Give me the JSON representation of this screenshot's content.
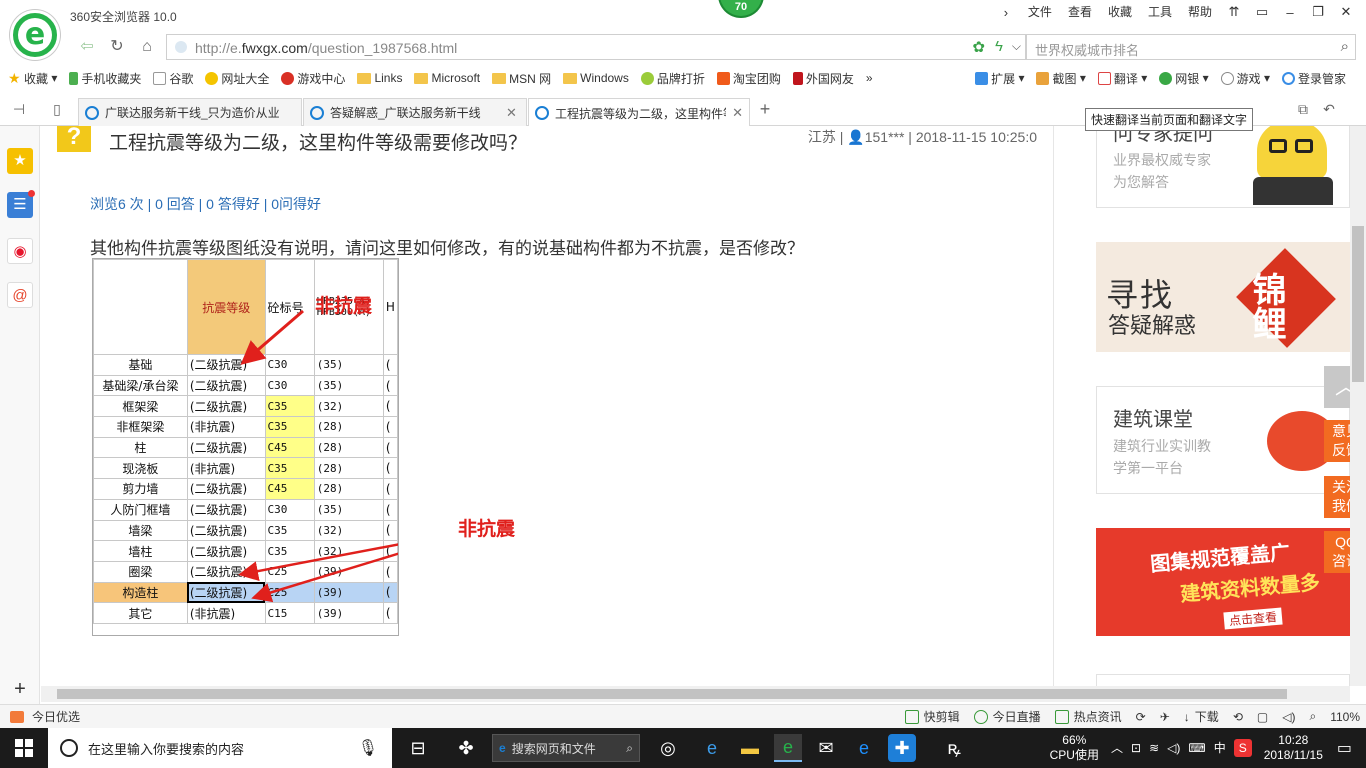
{
  "window": {
    "title": "360安全浏览器 10.0",
    "score": "70",
    "menu": [
      "文件",
      "查看",
      "收藏",
      "工具",
      "帮助"
    ]
  },
  "address": {
    "url_prefix": "http://e.",
    "url_domain": "fwxgx.com",
    "url_path": "/question_1987568.html",
    "search_placeholder": "世界权威城市排名"
  },
  "bookmarks": {
    "left": [
      "收藏",
      "手机收藏夹",
      "谷歌",
      "网址大全",
      "游戏中心",
      "Links",
      "Microsoft",
      "MSN 网",
      "Windows",
      "品牌打折",
      "淘宝团购",
      "外国网友"
    ],
    "more": "»",
    "right": [
      "扩展",
      "截图",
      "翻译",
      "网银",
      "游戏",
      "登录管家"
    ]
  },
  "tabs": [
    {
      "label": "广联达服务新干线_只为造价从业"
    },
    {
      "label": "答疑解惑_广联达服务新干线"
    },
    {
      "label": "工程抗震等级为二级，这里构件等"
    }
  ],
  "tooltip": "快速翻译当前页面和翻译文字",
  "question": {
    "icon": "?",
    "title": "工程抗震等级为二级，这里构件等级需要修改吗？",
    "meta": "江苏 | 👤151*** | 2018-11-15 10:25:0",
    "stats": "浏览6 次 | 0 回答 | 0 答得好 | 0问得好",
    "body": "其他构件抗震等级图纸没有说明，请问这里如何修改，有的说基础构件都为不抗震，是否修改？"
  },
  "figure": {
    "header_level": "抗震等级",
    "header_concrete": "砼标号",
    "header_steel": "HPB235(A)\nHPB300(A)",
    "header_h": "H",
    "rows": [
      {
        "name": "基础",
        "level": "(二级抗震)",
        "conc": "C30",
        "steel": "(35)",
        "yellow": false
      },
      {
        "name": "基础梁/承台梁",
        "level": "(二级抗震)",
        "conc": "C30",
        "steel": "(35)",
        "yellow": false
      },
      {
        "name": "框架梁",
        "level": "(二级抗震)",
        "conc": "C35",
        "steel": "(32)",
        "yellow": true
      },
      {
        "name": "非框架梁",
        "level": "(非抗震)",
        "conc": "C35",
        "steel": "(28)",
        "yellow": true
      },
      {
        "name": "柱",
        "level": "(二级抗震)",
        "conc": "C45",
        "steel": "(28)",
        "yellow": true
      },
      {
        "name": "现浇板",
        "level": "(非抗震)",
        "conc": "C35",
        "steel": "(28)",
        "yellow": true
      },
      {
        "name": "剪力墙",
        "level": "(二级抗震)",
        "conc": "C45",
        "steel": "(28)",
        "yellow": true
      },
      {
        "name": "人防门框墙",
        "level": "(二级抗震)",
        "conc": "C30",
        "steel": "(35)",
        "yellow": false
      },
      {
        "name": "墙梁",
        "level": "(二级抗震)",
        "conc": "C35",
        "steel": "(32)",
        "yellow": false
      },
      {
        "name": "墙柱",
        "level": "(二级抗震)",
        "conc": "C35",
        "steel": "(32)",
        "yellow": false
      },
      {
        "name": "圈梁",
        "level": "(二级抗震)",
        "conc": "C25",
        "steel": "(39)",
        "yellow": false
      },
      {
        "name": "构造柱",
        "level": "(二级抗震)",
        "conc": "C25",
        "steel": "(39)",
        "yellow": false,
        "selected": true
      },
      {
        "name": "其它",
        "level": "(非抗震)",
        "conc": "C15",
        "steel": "(39)",
        "yellow": false
      }
    ],
    "annotation_1": "非抗震",
    "annotation_2": "非抗震"
  },
  "sidebar_right": {
    "ad1_title": "问专家提问",
    "ad1_sub1": "业界最权威专家",
    "ad1_sub2": "为您解答",
    "ad2_text1": "寻找",
    "ad2_text2": "答疑解惑",
    "ad2_text3": "锦鲤",
    "ad3_title": "建筑课堂",
    "ad3_sub1": "建筑行业实训教",
    "ad3_sub2": "学第一平台",
    "ad4_text1": "图集规范覆盖广",
    "ad4_text2": "建筑资料数量多",
    "ad4_text3": "点击查看"
  },
  "float_panel": {
    "top_icon": "︿",
    "feedback": "意见反馈",
    "contact": "关注我们",
    "qq": "QQ咨询"
  },
  "statusbar": {
    "left": "今日优选",
    "items": [
      "快剪辑",
      "今日直播",
      "热点资讯",
      "下载"
    ],
    "zoom": "110%"
  },
  "taskbar": {
    "search_placeholder": "在这里输入你要搜索的内容",
    "browser_search": "搜索网页和文件",
    "cpu_percent": "66%",
    "cpu_label": "CPU使用",
    "ime": "中",
    "time": "10:28",
    "date": "2018/11/15"
  }
}
